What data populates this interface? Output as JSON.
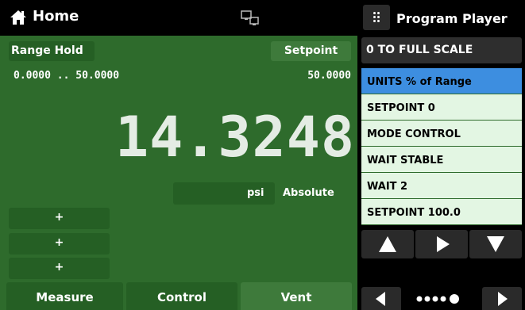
{
  "header": {
    "title": "Home",
    "home_icon": "home-icon",
    "network_icon": "network-icon"
  },
  "program_header": {
    "menu_icon": "grid-menu-icon",
    "title": "Program Player"
  },
  "main": {
    "range_hold_label": "Range Hold",
    "setpoint_label": "Setpoint",
    "range_text": "0.0000 .. 50.0000",
    "setpoint_value": "50.0000",
    "reading": "14.3248",
    "unit": "psi",
    "mode": "Absolute",
    "plus_buttons": [
      "+",
      "+",
      "+"
    ],
    "background_color": "#2e6b2c"
  },
  "tabs": {
    "measure": "Measure",
    "control": "Control",
    "vent": "Vent"
  },
  "program": {
    "name": "0 TO FULL SCALE",
    "steps": [
      "UNITS % of Range",
      "SETPOINT 0",
      "MODE CONTROL",
      "WAIT STABLE",
      "WAIT 2",
      "SETPOINT 100.0"
    ],
    "active_step_index": 0,
    "active_color": "#3d8ee0",
    "controls": [
      "up-arrow-icon",
      "play-icon",
      "down-arrow-icon"
    ],
    "page_nav": [
      "left-arrow-icon",
      "page-dots-indicator",
      "right-arrow-icon"
    ]
  }
}
